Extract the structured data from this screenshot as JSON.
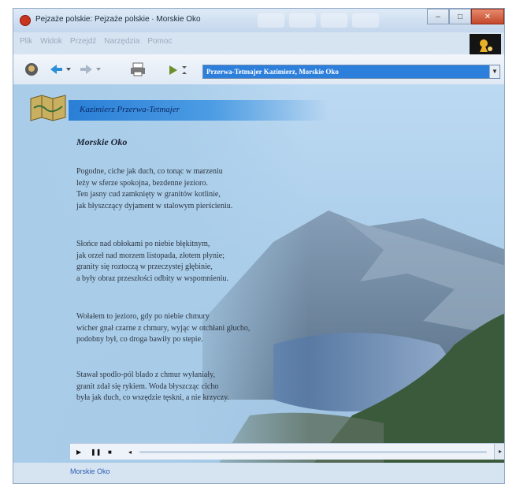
{
  "window": {
    "title": "Pejzaże polskie: Pejzaże polskie · Morskie Oko",
    "controls": {
      "minimize": "–",
      "maximize": "□",
      "close": "✕"
    }
  },
  "menu": [
    "Plik",
    "Widok",
    "Przejdź",
    "Narzędzia",
    "Pomoc"
  ],
  "toolbar": {
    "address": "Przerwa-Tetmajer Kazimierz, Morskie Oko",
    "icons": [
      "home-icon",
      "back-icon",
      "forward-icon",
      "print-icon",
      "play-icon"
    ]
  },
  "content": {
    "author_heading": "Kazimierz Przerwa-Tetmajer",
    "poem_title": "Morskie Oko",
    "stanzas": [
      [
        "Pogodne, ciche jak duch, co tonąc w marzeniu",
        "leży w sferze spokojna, bezdenne jezioro.",
        "Ten jasny cud zamknięty w granitów kotlinie,",
        "jak błyszczący dyjament w stalowym pierścieniu."
      ],
      [
        "Słońce nad obłokami po niebie błękitnym,",
        "jak orzeł nad morzem listopada, złotem płynie;",
        "granity się roztoczą w przeczystej głębinie,",
        "a były obraz przeszłości odbity w wspomnieniu."
      ],
      [
        "Wołałem to jezioro, gdy po niebie chmury",
        "wicher gnał czarne z chmury, wyjąc w otchłani głucho,",
        "podobny był, co droga bawiły po stepie."
      ],
      [
        "Stawał spodlo-pól blado z chmur wyłaniały,",
        "granit zdał się rykiem. Woda błyszcząc cicho",
        "była jak duch, co wszędzie tęskni, a nie krzyczy."
      ]
    ]
  },
  "status": {
    "text": "Morskie Oko"
  },
  "colors": {
    "accent": "#2d7fdc",
    "close": "#c4482a",
    "header_band": "#2a7fd6"
  }
}
